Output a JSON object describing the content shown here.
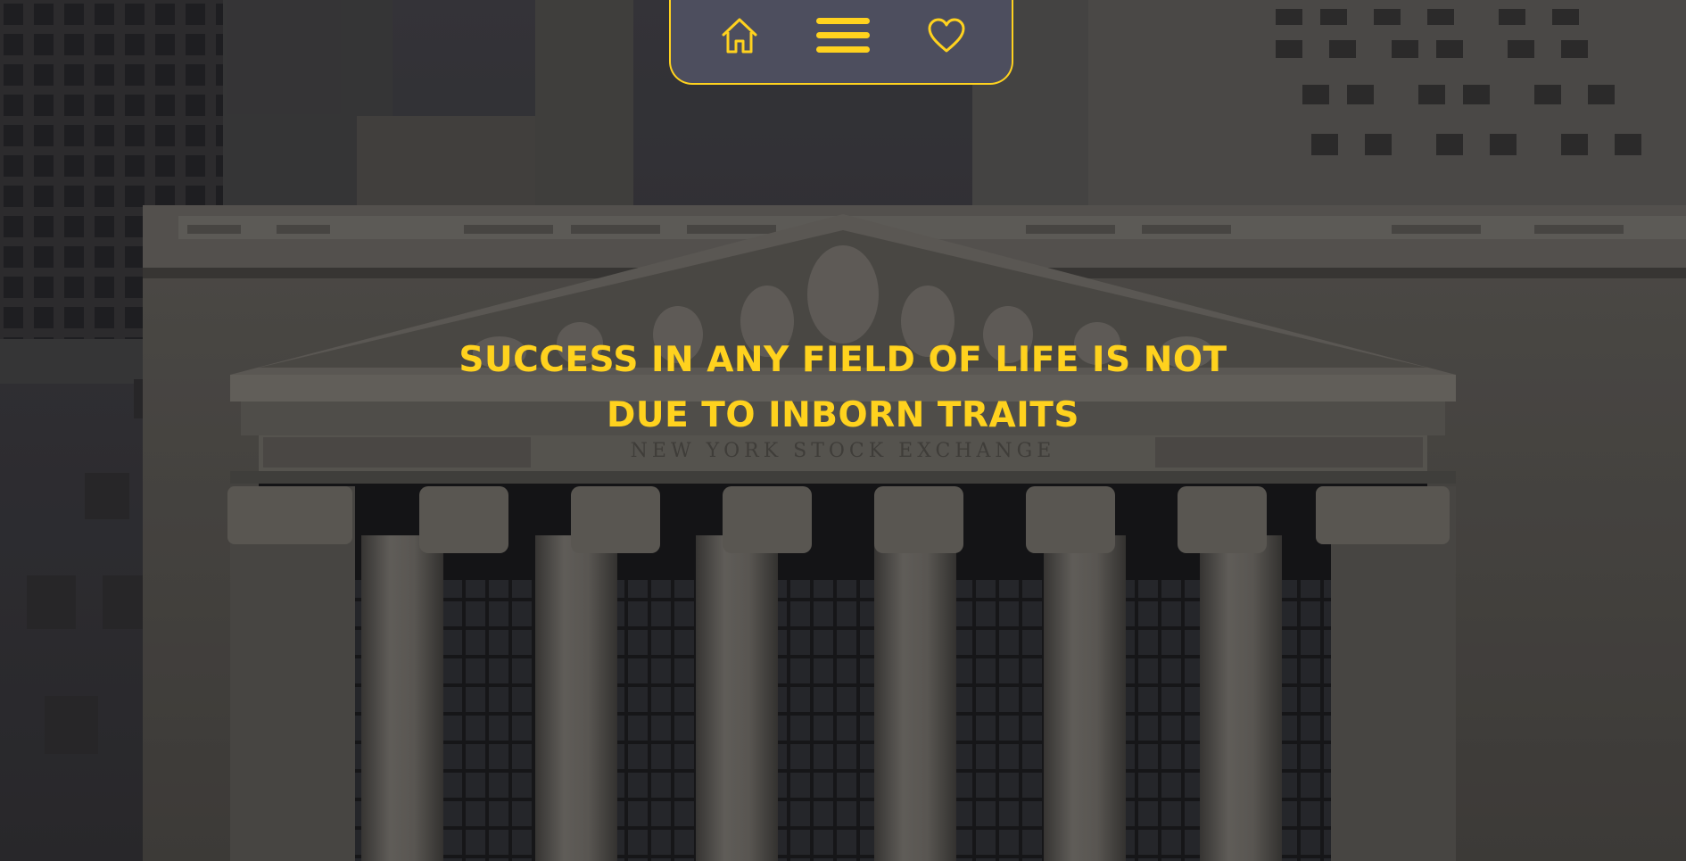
{
  "nav": {
    "home_icon": "home-icon",
    "menu_icon": "hamburger-menu-icon",
    "favorites_icon": "heart-icon",
    "accent_color": "#ffd21e",
    "background_color": "#4d4e5e"
  },
  "hero": {
    "headline_line1": "SUCCESS IN ANY FIELD OF LIFE IS NOT",
    "headline_line2": "DUE TO INBORN TRAITS",
    "frieze_text": "NEW YORK STOCK EXCHANGE",
    "background": "stock-exchange-building-photo"
  }
}
